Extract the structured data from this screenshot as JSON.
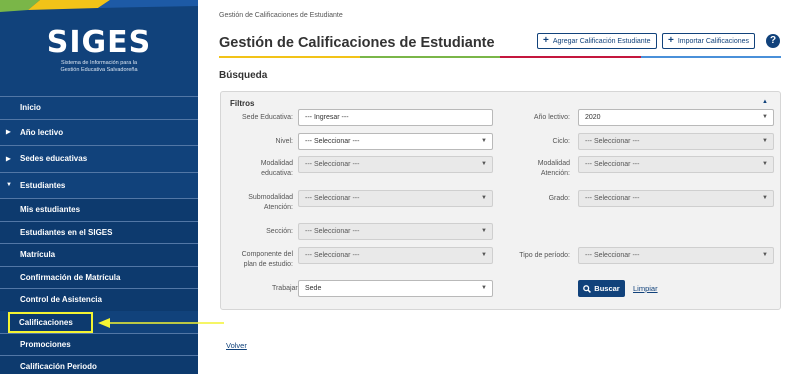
{
  "sidebar": {
    "logo_title": "SIGES",
    "logo_subtitle_1": "Sistema de Información para la",
    "logo_subtitle_2": "Gestión Educativa Salvadoreña",
    "items": [
      {
        "label": "Inicio"
      },
      {
        "label": "Año lectivo"
      },
      {
        "label": "Sedes educativas"
      },
      {
        "label": "Estudiantes"
      },
      {
        "label": "Mis estudiantes"
      },
      {
        "label": "Estudiantes en el SIGES"
      },
      {
        "label": "Matrícula"
      },
      {
        "label": "Confirmación de Matrícula"
      },
      {
        "label": "Control de Asistencia"
      },
      {
        "label": "Calificaciones"
      },
      {
        "label": "Promociones"
      },
      {
        "label": "Calificación Periodo"
      }
    ]
  },
  "header": {
    "breadcrumb": "Gestión de Calificaciones de Estudiante",
    "title": "Gestión de Calificaciones de Estudiante",
    "add_button": "Agregar Calificación Estudiante",
    "import_button": "Importar Calificaciones",
    "help_symbol": "?"
  },
  "search": {
    "section_title": "Búsqueda",
    "filters_title": "Filtros",
    "fields": {
      "sede": {
        "label": "Sede Educativa:",
        "placeholder": "--- Ingresar ---"
      },
      "anio": {
        "label": "Año lectivo:",
        "value": "2020"
      },
      "nivel": {
        "label": "Nivel:",
        "value": "--- Seleccionar ---"
      },
      "ciclo": {
        "label": "Ciclo:",
        "value": "--- Seleccionar ---"
      },
      "modalidad_edu": {
        "label_1": "Modalidad",
        "label_2": "educativa:",
        "value": "--- Seleccionar ---"
      },
      "modalidad_aten": {
        "label_1": "Modalidad",
        "label_2": "Atención:",
        "value": "--- Seleccionar ---"
      },
      "submodalidad": {
        "label_1": "Submodalidad",
        "label_2": "Atención:",
        "value": "--- Seleccionar ---"
      },
      "grado": {
        "label": "Grado:",
        "value": "--- Seleccionar ---"
      },
      "seccion": {
        "label": "Sección:",
        "value": "--- Seleccionar ---"
      },
      "componente": {
        "label_1": "Componente del",
        "label_2": "plan de estudio:",
        "value": "--- Seleccionar ---"
      },
      "tipo_periodo": {
        "label": "Tipo de período:",
        "value": "--- Seleccionar ---"
      },
      "trabajar_con": {
        "label": "Trabajar con",
        "value": "Sede"
      }
    },
    "search_button": "Buscar",
    "clear_link": "Limpiar"
  },
  "footer": {
    "back_link": "Volver"
  },
  "colors": {
    "primary": "#11427b",
    "highlight": "#f4f432",
    "bar": [
      "#f2c318",
      "#7ab648",
      "#c4173d",
      "#4a90d9"
    ]
  }
}
